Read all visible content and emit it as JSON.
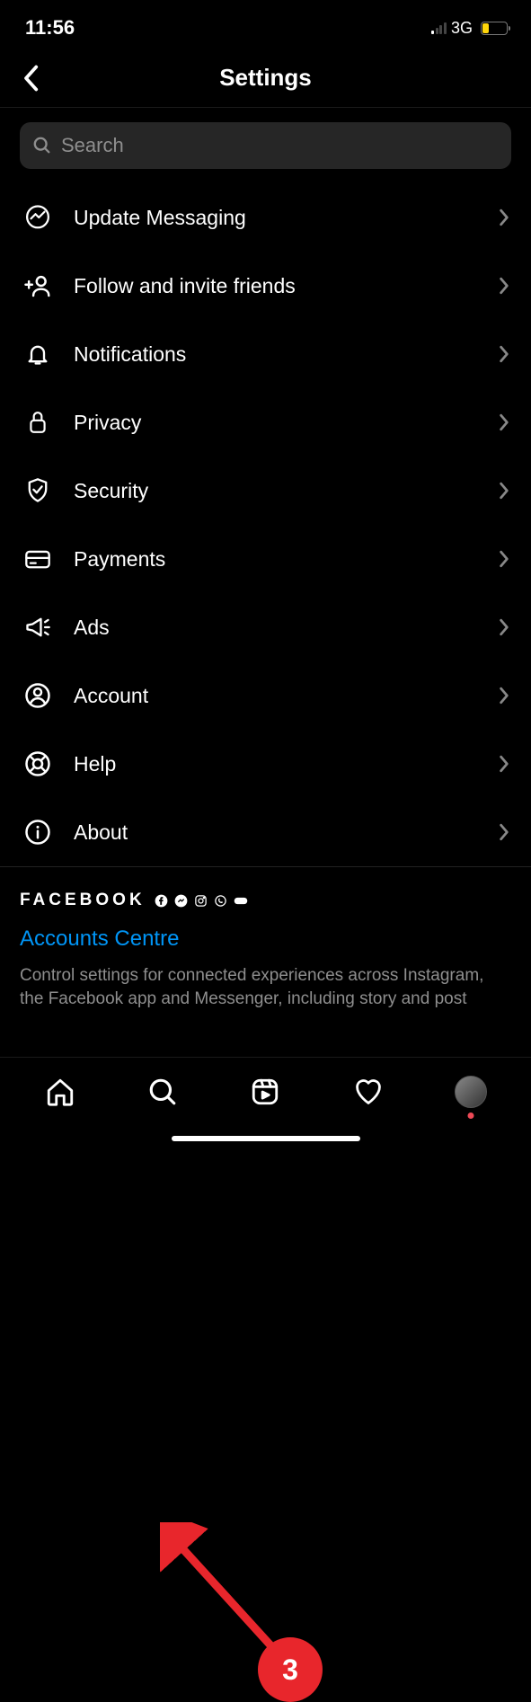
{
  "status": {
    "time": "11:56",
    "network": "3G"
  },
  "header": {
    "title": "Settings"
  },
  "search": {
    "placeholder": "Search"
  },
  "menu": {
    "items": [
      {
        "label": "Update Messaging"
      },
      {
        "label": "Follow and invite friends"
      },
      {
        "label": "Notifications"
      },
      {
        "label": "Privacy"
      },
      {
        "label": "Security"
      },
      {
        "label": "Payments"
      },
      {
        "label": "Ads"
      },
      {
        "label": "Account"
      },
      {
        "label": "Help"
      },
      {
        "label": "About"
      }
    ]
  },
  "footer": {
    "brand": "FACEBOOK",
    "link": "Accounts Centre",
    "description": "Control settings for connected experiences across Instagram, the Facebook app and Messenger, including story and post"
  },
  "annotation": {
    "step": "3"
  }
}
